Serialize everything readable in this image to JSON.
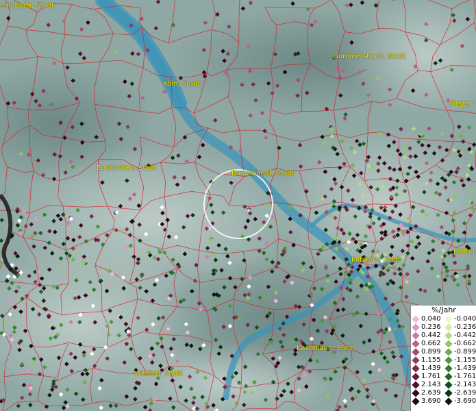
{
  "map": {
    "colors": {
      "water": "#3d94b8",
      "border": "#d8222a",
      "label": "#e8e000"
    },
    "cities": [
      {
        "id": "monchengladbach",
        "label": "nglabach, Stadt"
      },
      {
        "id": "gummersbach",
        "label": "Gummersbach, Stadt"
      },
      {
        "id": "koln",
        "label": "Köln, Stadt"
      },
      {
        "id": "siegen",
        "label": "Siegen"
      },
      {
        "id": "euskirchen",
        "label": "Euskirchen, Stadt"
      },
      {
        "id": "bad-honnef",
        "label": "Bad Honnef, Stadt"
      },
      {
        "id": "koblenz",
        "label": "Koblenz, Stadt"
      },
      {
        "id": "limburg",
        "label": "Limbu"
      },
      {
        "id": "kastellaun",
        "label": "Kastellaun, Stadt"
      },
      {
        "id": "wittlich",
        "label": "Wittlich, Stadt"
      }
    ]
  },
  "legend": {
    "title": "%/Jahr",
    "positive": [
      {
        "value": "0.040",
        "color": "#f4b8de"
      },
      {
        "value": "0.236",
        "color": "#e295c4"
      },
      {
        "value": "0.442",
        "color": "#cf7aa6"
      },
      {
        "value": "0.662",
        "color": "#b9628a"
      },
      {
        "value": "0.899",
        "color": "#a44c72"
      },
      {
        "value": "1.155",
        "color": "#8e3a5d"
      },
      {
        "value": "1.439",
        "color": "#77294a"
      },
      {
        "value": "1.761",
        "color": "#621d3a"
      },
      {
        "value": "2.143",
        "color": "#4c122c"
      },
      {
        "value": "2.639",
        "color": "#370a1e"
      },
      {
        "value": "3.690",
        "color": "#200411"
      }
    ],
    "negative": [
      {
        "value": "-0.040",
        "color": "#f4f8c8"
      },
      {
        "value": "-0.236",
        "color": "#d8ecaa"
      },
      {
        "value": "-0.442",
        "color": "#b6da88"
      },
      {
        "value": "-0.662",
        "color": "#92c66a"
      },
      {
        "value": "-0.899",
        "color": "#6fae52"
      },
      {
        "value": "-1.155",
        "color": "#4e9640"
      },
      {
        "value": "-1.439",
        "color": "#357c32"
      },
      {
        "value": "-1.761",
        "color": "#226326"
      },
      {
        "value": "-2.143",
        "color": "#144b1c"
      },
      {
        "value": "-2.639",
        "color": "#0a3312"
      },
      {
        "value": "-3.690",
        "color": "#031d08"
      }
    ]
  }
}
